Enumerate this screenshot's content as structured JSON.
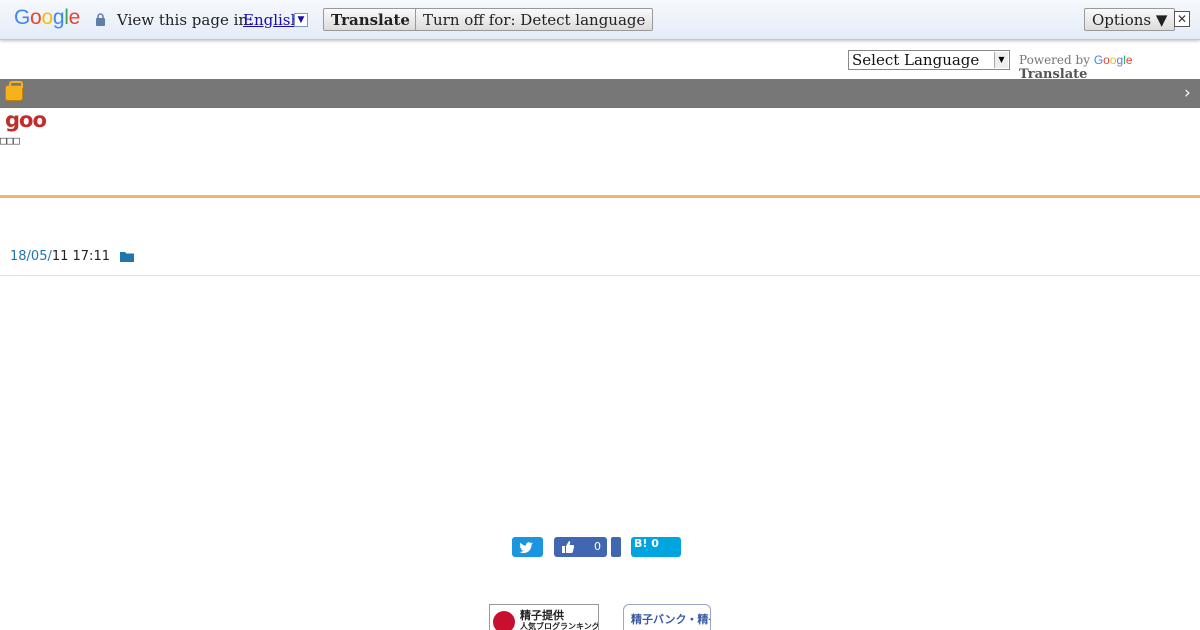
{
  "translate_bar": {
    "logo_letters": [
      "G",
      "o",
      "o",
      "g",
      "l",
      "e"
    ],
    "view_label": "View this page in:",
    "language_link": "English",
    "dropdown_glyph": "▼",
    "translate_button": "Translate",
    "turn_off_button": "Turn off for: Detect language",
    "options_button": "Options ▼",
    "close_glyph": "✕"
  },
  "language_widget": {
    "select_value": "Select Language",
    "powered_by": "Powered by",
    "google_letters": [
      "G",
      "o",
      "o",
      "g",
      "l",
      "e"
    ],
    "translate_word": "Translate"
  },
  "header": {
    "chevron": "›",
    "goo_logo": "goo",
    "blog_subtitle": "□□□"
  },
  "post": {
    "date_link": "18/05/",
    "date_rest": "11 17:11"
  },
  "share": {
    "facebook_count": "0",
    "hatena_label": "B! 0"
  },
  "banners": {
    "ranking_line1": "精子提供",
    "ranking_line2": "人気ブログランキング",
    "bank_label": "精子バンク・精子提供"
  },
  "colors": {
    "accent_orange": "#f6b266",
    "header_strip": "#777777",
    "twitter": "#1b95e0",
    "facebook": "#4267b2",
    "hatena": "#00a4de",
    "goo_red": "#c42b2b"
  }
}
